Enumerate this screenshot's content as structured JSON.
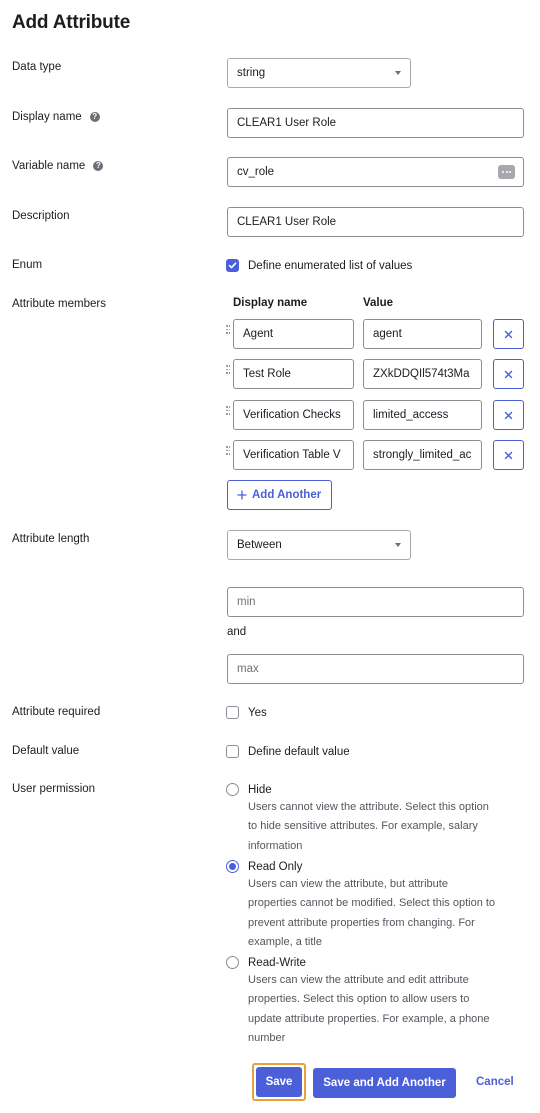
{
  "page": {
    "title": "Add Attribute"
  },
  "fields": {
    "data_type": {
      "label": "Data type",
      "value": "string"
    },
    "display_name": {
      "label": "Display name",
      "value": "CLEAR1 User Role"
    },
    "variable_name": {
      "label": "Variable name",
      "value": "cv_role"
    },
    "description": {
      "label": "Description",
      "value": "CLEAR1 User Role"
    },
    "enum": {
      "label": "Enum",
      "checkbox_label": "Define enumerated list of values",
      "checked": true
    }
  },
  "members": {
    "label": "Attribute members",
    "col_display": "Display name",
    "col_value": "Value",
    "rows": [
      {
        "display": "Agent",
        "value": "agent"
      },
      {
        "display": "Test Role",
        "value": "ZXkDDQIl574t3Ma"
      },
      {
        "display": "Verification Checks",
        "value": "limited_access"
      },
      {
        "display": "Verification Table V",
        "value": "strongly_limited_ac"
      }
    ],
    "add_label": "Add Another"
  },
  "length": {
    "label": "Attribute length",
    "value": "Between",
    "min_placeholder": "min",
    "and_label": "and",
    "max_placeholder": "max"
  },
  "required": {
    "label": "Attribute required",
    "option": "Yes",
    "checked": false
  },
  "default_value": {
    "label": "Default value",
    "option": "Define default value",
    "checked": false
  },
  "permission": {
    "label": "User permission",
    "options": [
      {
        "label": "Hide",
        "desc_lines": [
          "Users cannot view the attribute. Select this option",
          "to hide sensitive attributes. For example, salary",
          "information"
        ],
        "checked": false
      },
      {
        "label": "Read Only",
        "desc_lines": [
          "Users can view the attribute, but attribute",
          "properties cannot be modified. Select this option to",
          "prevent attribute properties from changing. For",
          "example, a title"
        ],
        "checked": true
      },
      {
        "label": "Read-Write",
        "desc_lines": [
          "Users can view the attribute and edit attribute",
          "properties. Select this option to allow users to",
          "update attribute properties. For example, a phone",
          "number"
        ],
        "checked": false
      }
    ]
  },
  "actions": {
    "save": "Save",
    "save_add": "Save and Add Another",
    "cancel": "Cancel"
  },
  "colors": {
    "accent": "#4b5fd8",
    "focus_outline": "#e6a23c",
    "border": "#8c8c96"
  },
  "icons": {
    "help": "question-circle-icon",
    "more": "more-dots-icon",
    "remove": "close-icon",
    "add": "plus-icon",
    "drag": "drag-handle-icon",
    "caret": "chevron-down-icon",
    "check": "checkmark-icon"
  }
}
